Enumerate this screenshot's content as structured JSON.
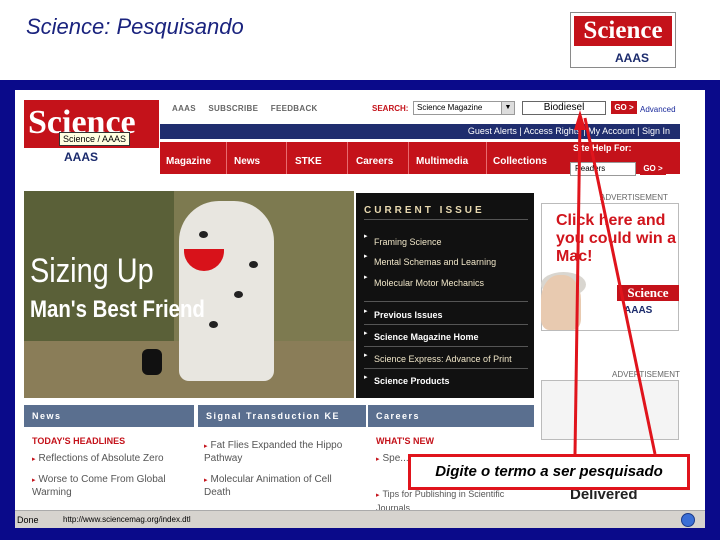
{
  "slide": {
    "title": "Science: Pesquisando",
    "corner_logo_text": "Science",
    "corner_logo_aaas": "AAAS"
  },
  "browser": {
    "status_text": "Done",
    "status_url": "http://www.sciencemag.org/index.dtl"
  },
  "header": {
    "logo_text": "Science",
    "logo_aaas": "AAAS",
    "tooltip": "Science / AAAS",
    "top_links": [
      "AAAS",
      "SUBSCRIBE",
      "FEEDBACK"
    ],
    "search_label": "SEARCH:",
    "search_scope": "Science Magazine",
    "search_value": "Biodiesel",
    "go_label": "GO >",
    "advanced_label": "Advanced",
    "account_links": "Guest  Alerts | Access Rights | My Account | Sign In",
    "site_help_label": "Site Help For:",
    "site_help_value": "Readers",
    "nav": [
      "Magazine",
      "News",
      "STKE",
      "Careers",
      "Multimedia",
      "Collections"
    ]
  },
  "hero": {
    "line1": "Sizing Up",
    "line2": "Man's Best Friend"
  },
  "current_issue": {
    "heading": "CURRENT ISSUE",
    "articles": [
      "Framing Science",
      "Mental Schemas and Learning",
      "Molecular Motor Mechanics"
    ],
    "links": [
      "Previous Issues",
      "Science Magazine Home",
      "Science Express: Advance of Print",
      "Science Products"
    ]
  },
  "ad": {
    "label": "ADVERTISEMENT",
    "text": "Click here and you could win a Mac!",
    "logo": "Science",
    "aaas": "AAAS",
    "label2": "ADVERTISEMENT"
  },
  "sections": {
    "news": {
      "heading": "News",
      "subheading": "TODAY'S HEADLINES",
      "items": [
        "Reflections of Absolute Zero",
        "Worse to Come From Global Warming"
      ]
    },
    "signal": {
      "heading": "Signal Transduction KE",
      "items": [
        "Fat Flies Expanded the Hippo Pathway",
        "Molecular Animation of Cell Death"
      ]
    },
    "careers": {
      "heading": "Careers",
      "subheading": "WHAT'S NEW",
      "items": [
        "Spe...",
        "Tips for Publishing in Scientific Journals"
      ],
      "promo": "Delivered"
    }
  },
  "callout": {
    "text": "Digite o termo a ser pesquisado"
  },
  "colors": {
    "science_red": "#c4121a",
    "nav_blue": "#1f2d6e",
    "frame_blue": "#0a0a8a",
    "callout_red": "#e0141c"
  }
}
